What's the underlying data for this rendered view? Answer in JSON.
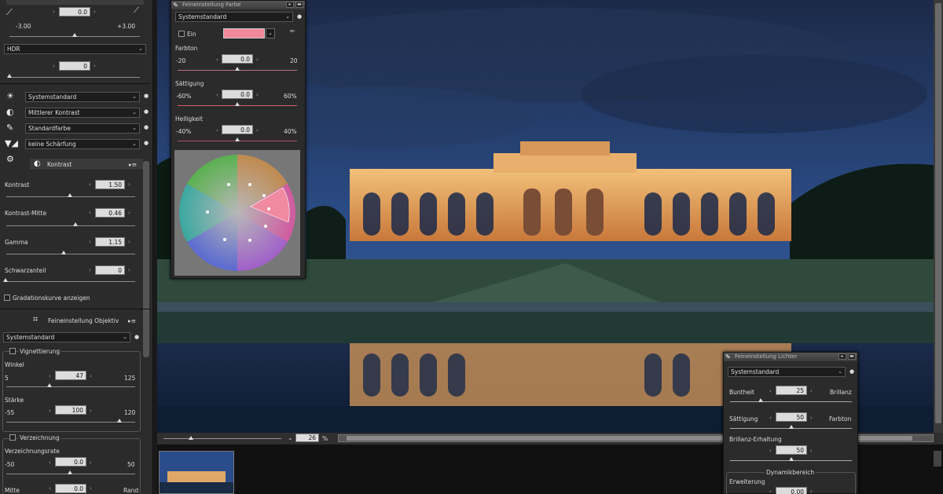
{
  "left": {
    "top_slider": {
      "value": "0.0",
      "min": "-3.00",
      "max": "+3.00"
    },
    "hdr": {
      "label": "HDR",
      "value": "0"
    },
    "presets": [
      {
        "icon": "sun-icon",
        "value": "Systemstandard"
      },
      {
        "icon": "contrast-icon",
        "value": "Mittlerer Kontrast"
      },
      {
        "icon": "brush-icon",
        "value": "Standardfarbe"
      },
      {
        "icon": "sharpen-icon",
        "value": "keine Schärfung"
      }
    ],
    "kontrast": {
      "title": "Kontrast",
      "rows": [
        {
          "label": "Kontrast",
          "value": "1.50"
        },
        {
          "label": "Kontrast-Mitte",
          "value": "0.46"
        },
        {
          "label": "Gamma",
          "value": "1.15"
        },
        {
          "label": "Schwarzanteil",
          "value": "0"
        }
      ],
      "checkbox": "Gradationskurve anzeigen"
    },
    "objektiv": {
      "title": "Feineinstellung Objektiv",
      "preset": "Systemstandard",
      "vignettierung": {
        "title": "Vignettierung",
        "winkel": {
          "label": "Winkel",
          "value": "47",
          "min": "5",
          "max": "125"
        },
        "staerke": {
          "label": "Stärke",
          "value": "100",
          "min": "-55",
          "max": "120"
        }
      },
      "verzeichnung": {
        "title": "Verzeichnung",
        "rate": {
          "label": "Verzeichnungsrate",
          "value": "0.0",
          "min": "-50",
          "max": "50"
        },
        "mitte": {
          "label": "Mitte",
          "value": "0.0",
          "max": "Rand"
        }
      }
    }
  },
  "farbe_panel": {
    "title": "Feineinstellung Farbe",
    "preset": "Systemstandard",
    "ein": "Ein",
    "swatch": "#f08a9a",
    "farbton": {
      "label": "Farbton",
      "value": "0.0",
      "min": "-20",
      "max": "20"
    },
    "saettigung": {
      "label": "Sättigung",
      "value": "0.0",
      "min": "-60%",
      "max": "60%"
    },
    "helligkeit": {
      "label": "Helligkeit",
      "value": "0.0",
      "min": "-40%",
      "max": "40%"
    }
  },
  "lichter_panel": {
    "title": "Feineinstellung Lichter",
    "preset": "Systemstandard",
    "bunt": {
      "label": "Buntheit",
      "value": "25",
      "right": "Brillanz"
    },
    "satt": {
      "label": "Sättigung",
      "value": "50",
      "right": "Farbton"
    },
    "brillanz": {
      "label": "Brillanz-Erhaltung",
      "value": "50"
    },
    "dynamik": "Dynamikbereich",
    "erweiterung": "Erweiterung",
    "erw_value": "0.00"
  },
  "zoom": {
    "value": "26",
    "unit": "%"
  },
  "colors": {
    "accent": "#f08a9a",
    "panel": "#2b2b2b"
  }
}
